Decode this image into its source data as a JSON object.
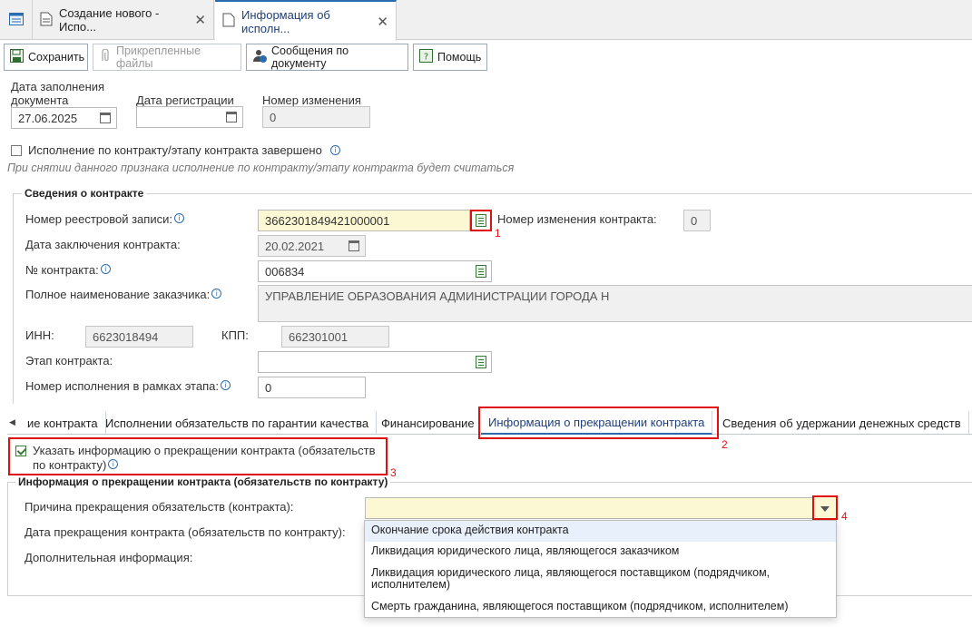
{
  "tabs": [
    {
      "label": "Создание нового - Испо..."
    },
    {
      "label": "Информация об исполн..."
    }
  ],
  "toolbar": {
    "save": "Сохранить",
    "files": "Прикрепленные файлы",
    "messages": "Сообщения по документу",
    "help": "Помощь"
  },
  "header": {
    "fill_date_label": "Дата заполнения документа",
    "fill_date_line1": "Дата заполнения",
    "fill_date_line2": "документа",
    "fill_date_value": "27.06.2025",
    "reg_date_label": "Дата регистрации",
    "reg_date_value": "",
    "change_num_label": "Номер изменения",
    "change_num_value": "0",
    "completed_label": "Исполнение по контракту/этапу контракта завершено",
    "hint": "При снятии данного признака исполнение по контракту/этапу контракта будет считаться"
  },
  "contract": {
    "section_title": "Сведения о контракте",
    "registry_label": "Номер реестровой записи:",
    "registry_value": "3662301849421000001",
    "change_label": "Номер изменения контракта:",
    "change_value": "0",
    "conclusion_label": "Дата заключения контракта:",
    "conclusion_value": "20.02.2021",
    "number_label": "№ контракта:",
    "number_value": "006834",
    "customer_label": "Полное наименование заказчика:",
    "customer_value": "УПРАВЛЕНИЕ ОБРАЗОВАНИЯ АДМИНИСТРАЦИИ ГОРОДА Н",
    "inn_label": "ИНН:",
    "inn_value": "6623018494",
    "kpp_label": "КПП:",
    "kpp_value": "662301001",
    "stage_label": "Этап контракта:",
    "stage_value": "",
    "exec_num_label": "Номер исполнения в рамках этапа:",
    "exec_num_value": "0"
  },
  "inner_tabs": [
    {
      "label": "ие контракта"
    },
    {
      "label": "Исполнении обязательств по гарантии качества"
    },
    {
      "label": "Финансирование"
    },
    {
      "label": "Информация о прекращении контракта"
    },
    {
      "label": "Сведения об удержании денежных средств"
    }
  ],
  "termination": {
    "checkbox_line1": "Указать информацию о прекращении контракта (обязательств",
    "checkbox_line2": "по контракту)",
    "section_title": "Информация о прекращении контракта (обязательств по контракту)",
    "reason_label": "Причина прекращения обязательств (контракта):",
    "reason_value": "",
    "date_label": "Дата прекращения контракта (обязательств по контракту):",
    "extra_label": "Дополнительная информация:",
    "options": [
      {
        "line1": "Окончание срока действия контракта",
        "line2": ""
      },
      {
        "line1": "Ликвидация юридического лица, являющегося заказчиком",
        "line2": ""
      },
      {
        "line1": "Ликвидация юридического лица, являющегося поставщиком (подрядчиком,",
        "line2": "исполнителем)"
      },
      {
        "line1": "Смерть гражданина, являющегося поставщиком (подрядчиком, исполнителем)",
        "line2": ""
      }
    ]
  },
  "markers": {
    "m1": "1",
    "m2": "2",
    "m3": "3",
    "m4": "4"
  },
  "colors": {
    "highlight_red": "#e01010",
    "accent_blue": "#2b6cb0",
    "required_yellow": "#fdf8d4"
  }
}
